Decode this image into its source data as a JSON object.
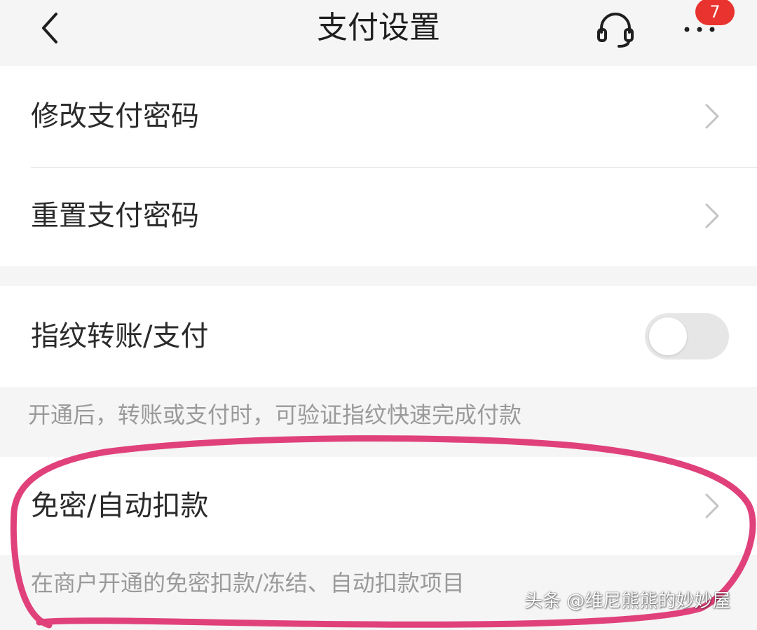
{
  "header": {
    "title": "支付设置",
    "back_icon": "chevron-left-icon",
    "service_icon": "headset-icon",
    "more_icon": "more-dots-icon",
    "badge_count": "7"
  },
  "password_section": {
    "items": [
      {
        "label": "修改支付密码",
        "icon": "chevron-right-icon"
      },
      {
        "label": "重置支付密码",
        "icon": "chevron-right-icon"
      }
    ]
  },
  "fingerprint_section": {
    "label": "指纹转账/支付",
    "toggle_on": false,
    "hint": "开通后，转账或支付时，可验证指纹快速完成付款"
  },
  "autopay_section": {
    "label": "免密/自动扣款",
    "icon": "chevron-right-icon",
    "hint": "在商户开通的免密扣款/冻结、自动扣款项目"
  },
  "watermark": "头条 @维尼熊熊的妙妙屋",
  "colors": {
    "badge": "#e9332e",
    "annotation": "#e0417a",
    "background": "#f5f5f5",
    "card": "#ffffff"
  }
}
